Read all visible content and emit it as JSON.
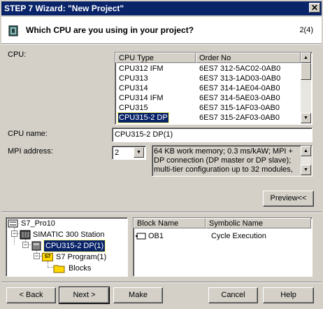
{
  "window": {
    "title": "STEP 7 Wizard: \"New Project\"",
    "close_glyph": "✕"
  },
  "header": {
    "question": "Which CPU are you using in your project?",
    "step": "2(4)"
  },
  "cpu": {
    "label": "CPU:",
    "columns": [
      "CPU Type",
      "Order No"
    ],
    "rows": [
      {
        "type": "CPU312 IFM",
        "order": "6ES7 312-5AC02-0AB0"
      },
      {
        "type": "CPU313",
        "order": "6ES7 313-1AD03-0AB0"
      },
      {
        "type": "CPU314",
        "order": "6ES7 314-1AE04-0AB0"
      },
      {
        "type": "CPU314 IFM",
        "order": "6ES7 314-5AE03-0AB0"
      },
      {
        "type": "CPU315",
        "order": "6ES7 315-1AF03-0AB0"
      },
      {
        "type": "CPU315-2 DP",
        "order": "6ES7 315-2AF03-0AB0"
      }
    ],
    "selected_index": 5
  },
  "cpu_name": {
    "label": "CPU name:",
    "value": "CPU315-2 DP(1)"
  },
  "mpi": {
    "label": "MPI address:",
    "value": "2",
    "description": "64 KB work memory; 0.3 ms/kAW; MPI + DP connection (DP master or DP slave); multi-tier configuration up to 32 modules,"
  },
  "preview_button": "Preview<<",
  "tree": {
    "items": [
      {
        "label": "S7_Pro10",
        "icon": "project-icon"
      },
      {
        "label": "SIMATIC 300 Station",
        "icon": "station-icon"
      },
      {
        "label": "CPU315-2 DP(1)",
        "icon": "cpu-icon"
      },
      {
        "label": "S7 Program(1)",
        "icon": "s7-program-icon",
        "badge": "S7"
      },
      {
        "label": "Blocks",
        "icon": "folder-icon"
      }
    ]
  },
  "blocks": {
    "columns": [
      "Block Name",
      "Symbolic Name"
    ],
    "rows": [
      {
        "name": "OB1",
        "symbol": "Cycle Execution"
      }
    ]
  },
  "buttons": {
    "back": "< Back",
    "next": "Next >",
    "make": "Make",
    "cancel": "Cancel",
    "help": "Help"
  },
  "colors": {
    "title_bar": "#0a246a",
    "face": "#d4d0c8",
    "selection": "#0a246a"
  }
}
